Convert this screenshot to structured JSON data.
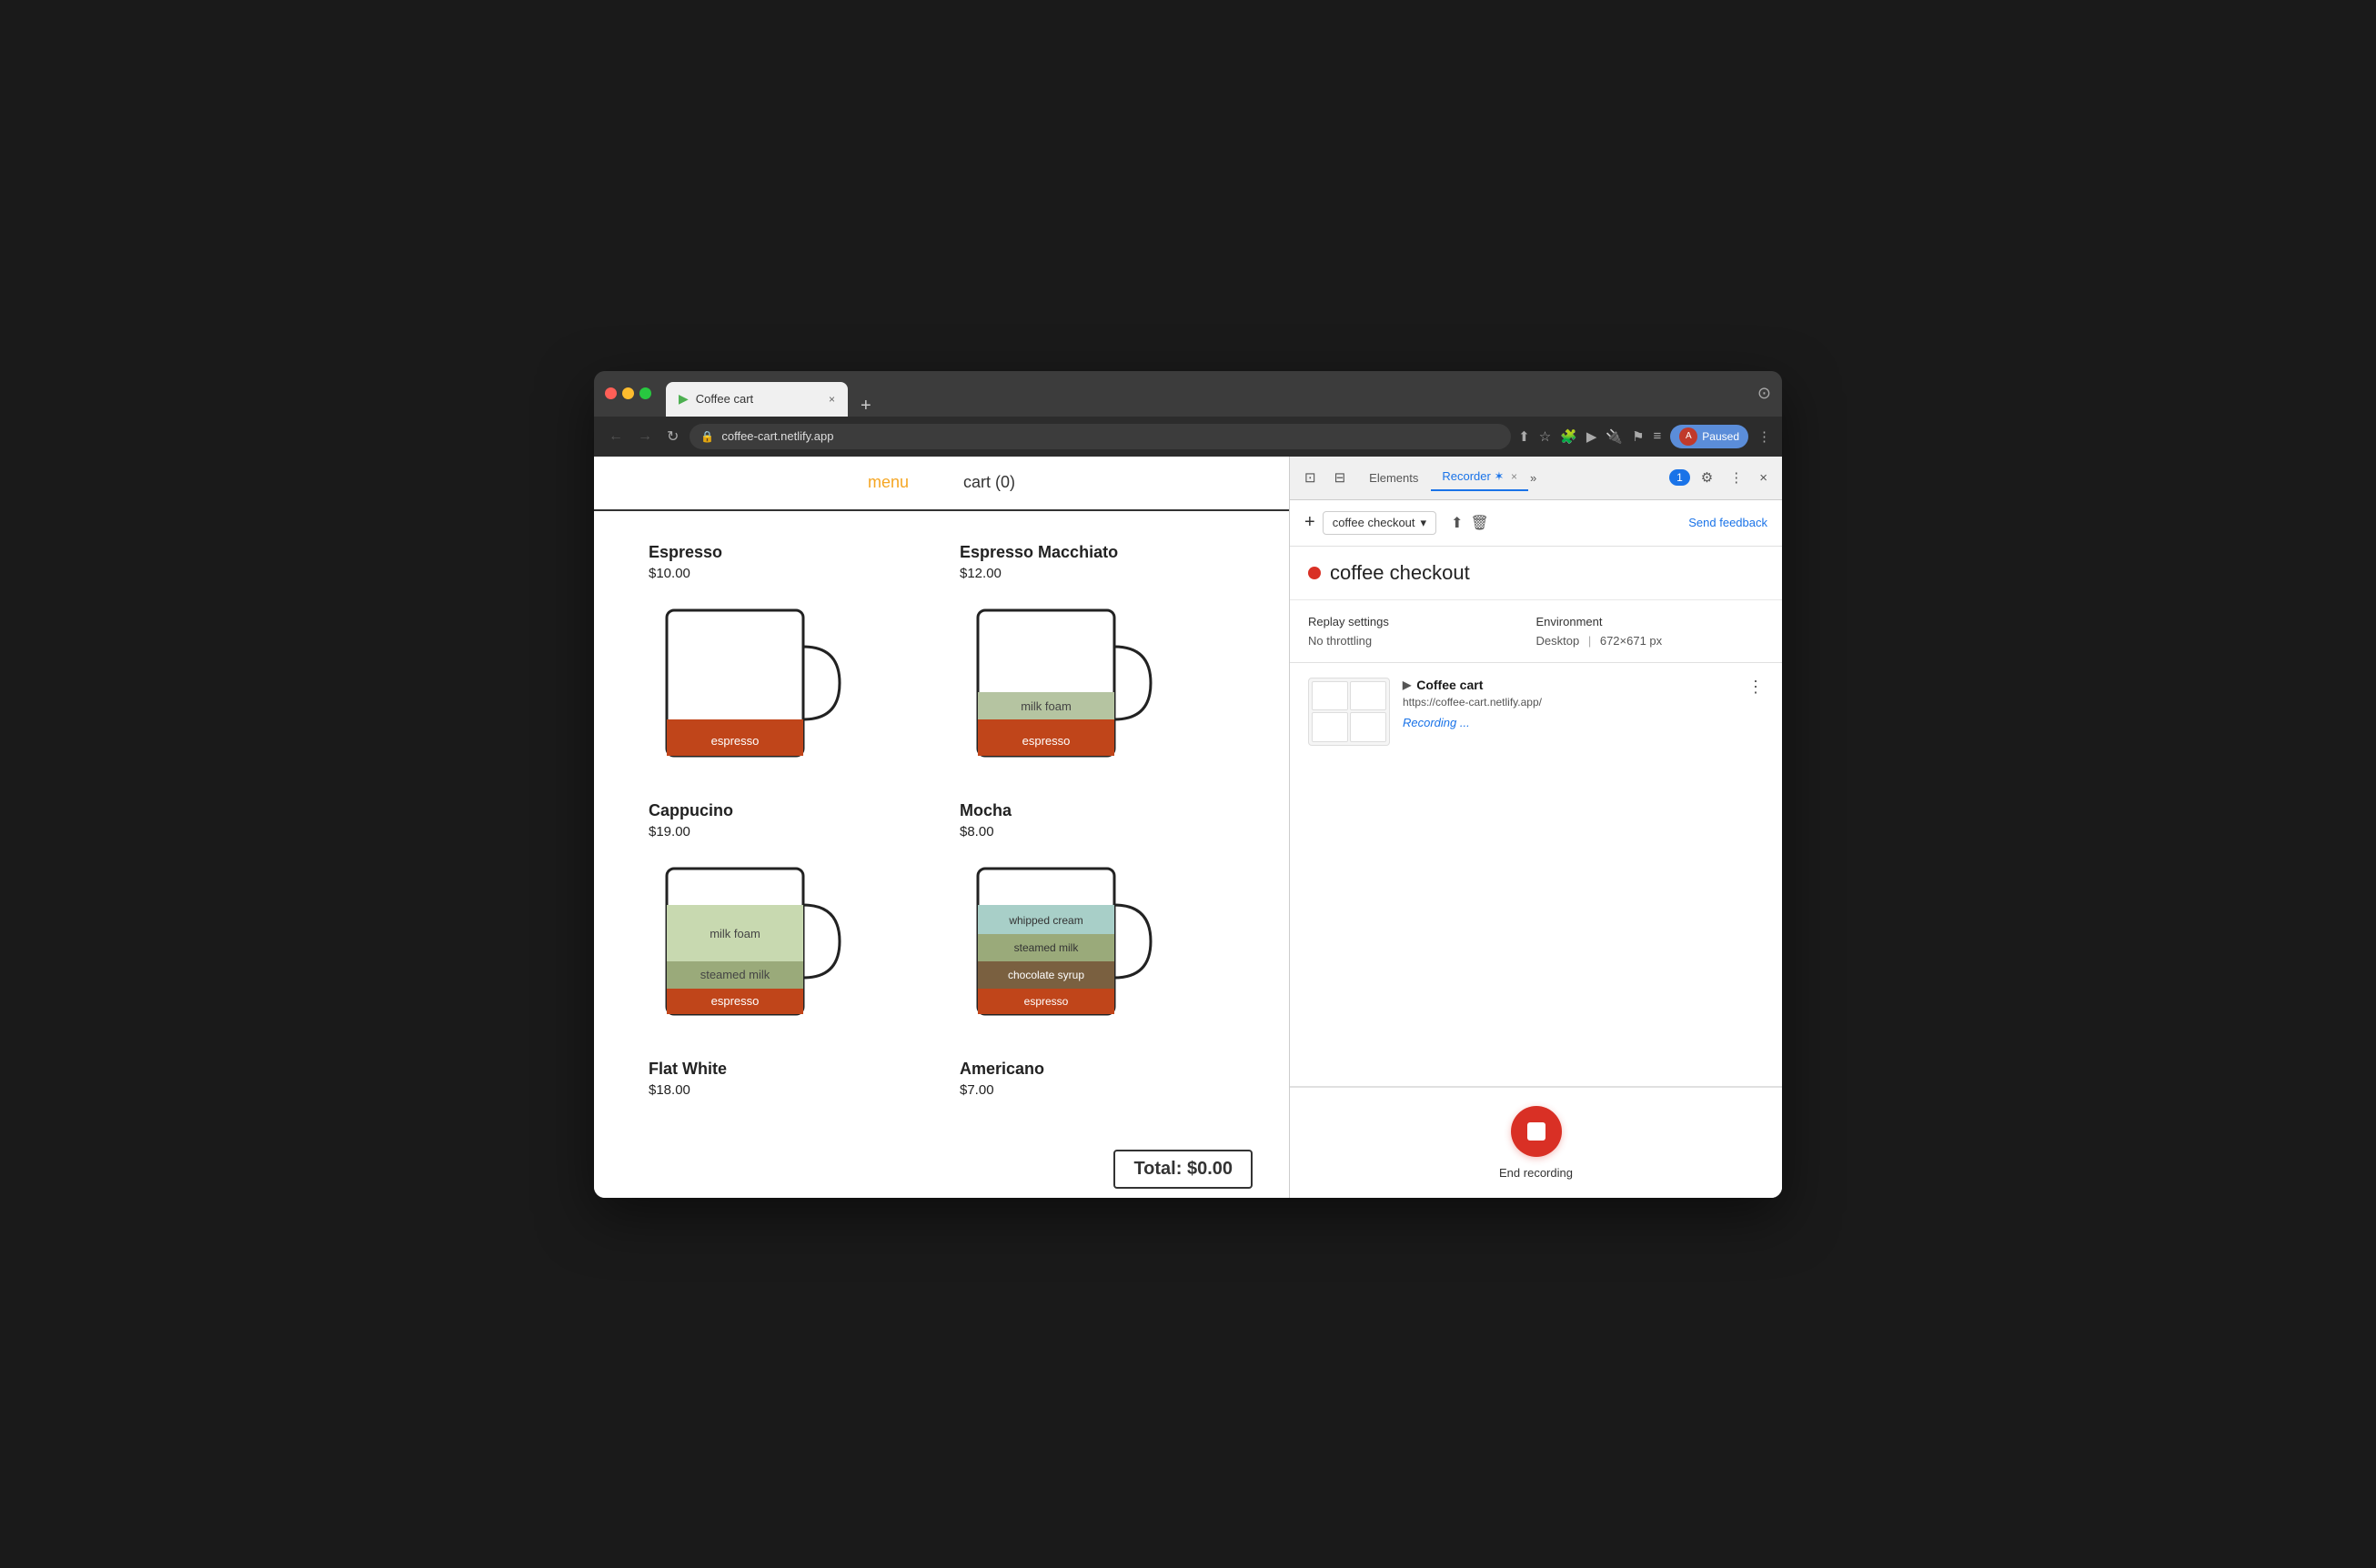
{
  "browser": {
    "tab_title": "Coffee cart",
    "tab_favicon": "▶",
    "url": "coffee-cart.netlify.app",
    "profile_label": "Paused",
    "new_tab_symbol": "+",
    "tab_close": "×"
  },
  "nav": {
    "menu_label": "menu",
    "cart_label": "cart (0)"
  },
  "coffees": [
    {
      "name": "Espresso",
      "price": "$10.00",
      "layers": [
        {
          "label": "espresso",
          "color": "#c0451a",
          "height": 35
        }
      ]
    },
    {
      "name": "Espresso Macchiato",
      "price": "$12.00",
      "layers": [
        {
          "label": "espresso",
          "color": "#c0451a",
          "height": 35
        },
        {
          "label": "milk foam",
          "color": "#b5c4a1",
          "height": 25
        }
      ]
    },
    {
      "name": "Cappucino",
      "price": "$19.00",
      "layers": [
        {
          "label": "espresso",
          "color": "#c0451a",
          "height": 28
        },
        {
          "label": "steamed milk",
          "color": "#9aaa7a",
          "height": 25
        },
        {
          "label": "milk foam",
          "color": "#c8d9b0",
          "height": 40
        }
      ]
    },
    {
      "name": "Mocha",
      "price": "$8.00",
      "layers": [
        {
          "label": "espresso",
          "color": "#c0451a",
          "height": 28
        },
        {
          "label": "chocolate syrup",
          "color": "#7a6040",
          "height": 25
        },
        {
          "label": "steamed milk",
          "color": "#9aaa7a",
          "height": 25
        },
        {
          "label": "whipped cream",
          "color": "#a8cfc8",
          "height": 28
        }
      ]
    },
    {
      "name": "Flat White",
      "price": "$18.00",
      "layers": []
    },
    {
      "name": "Americano",
      "price": "$7.00",
      "layers": []
    }
  ],
  "total": "Total: $0.00",
  "devtools": {
    "tabs": [
      "Elements",
      "Recorder ✶",
      ""
    ],
    "recorder_tab_label": "Recorder",
    "recorder_tab_star": "✶",
    "close": "×",
    "more": "»",
    "badge_count": "1",
    "settings_icon": "⚙",
    "more_dots": "⋮",
    "close_panel": "×"
  },
  "recorder": {
    "add_btn": "+",
    "dropdown_label": "coffee checkout",
    "upload_icon": "⬆",
    "delete_icon": "🗑",
    "send_feedback": "Send feedback",
    "recording_title": "coffee checkout",
    "replay_settings_label": "Replay settings",
    "no_throttling": "No throttling",
    "environment_label": "Environment",
    "desktop_label": "Desktop",
    "separator": "|",
    "resolution": "672×671 px",
    "entry_title": "Coffee cart",
    "entry_url": "https://coffee-cart.netlify.app/",
    "recording_status": "Recording ...",
    "end_recording_label": "End recording"
  }
}
